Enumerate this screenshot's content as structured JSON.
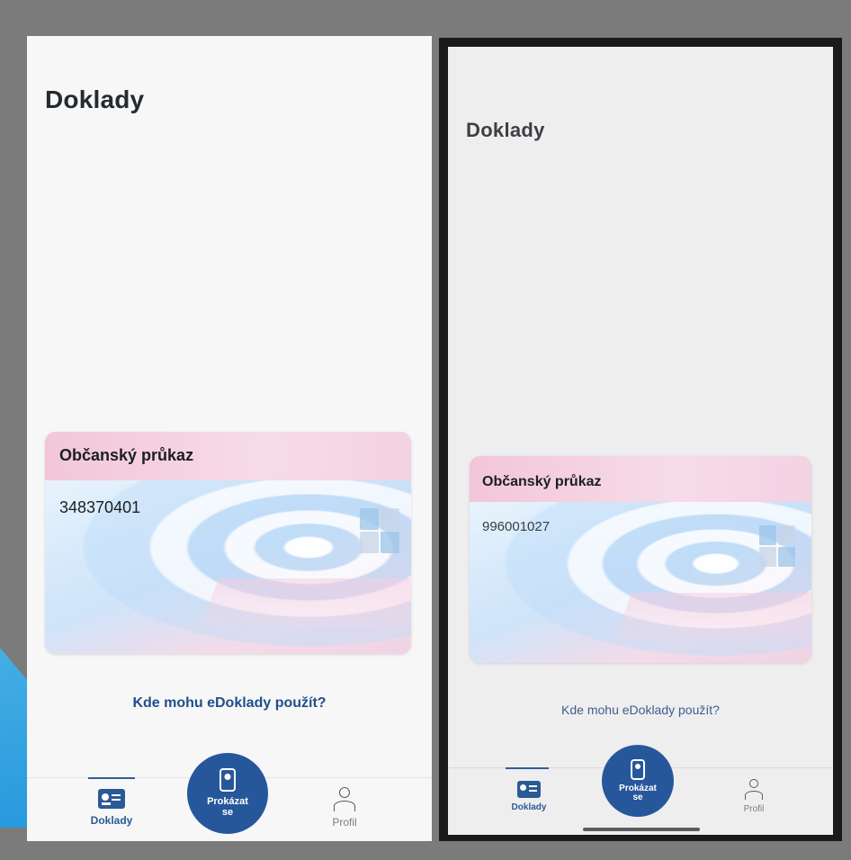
{
  "left_screen": {
    "title": "Doklady",
    "card": {
      "title": "Občanský průkaz",
      "number": "348370401"
    },
    "link": "Kde mohu eDoklady použít?",
    "nav": {
      "doklady": "Doklady",
      "prokazat": "Prokázat se",
      "profil": "Profil",
      "active": "doklady"
    }
  },
  "right_screen": {
    "title": "Doklady",
    "card": {
      "title": "Občanský průkaz",
      "number": "996001027"
    },
    "link": "Kde mohu eDoklady použít?",
    "nav": {
      "doklady": "Doklady",
      "prokazat": "Prokázat se",
      "profil": "Profil",
      "active": "doklady"
    }
  },
  "colors": {
    "primary": "#27579b",
    "link": "#1f4f8a",
    "card_header": "#f2c6d9",
    "background": "#7b7b7b"
  },
  "icons": [
    "id-card-icon",
    "phone-id-icon",
    "person-icon",
    "czech-emblem-icon"
  ]
}
